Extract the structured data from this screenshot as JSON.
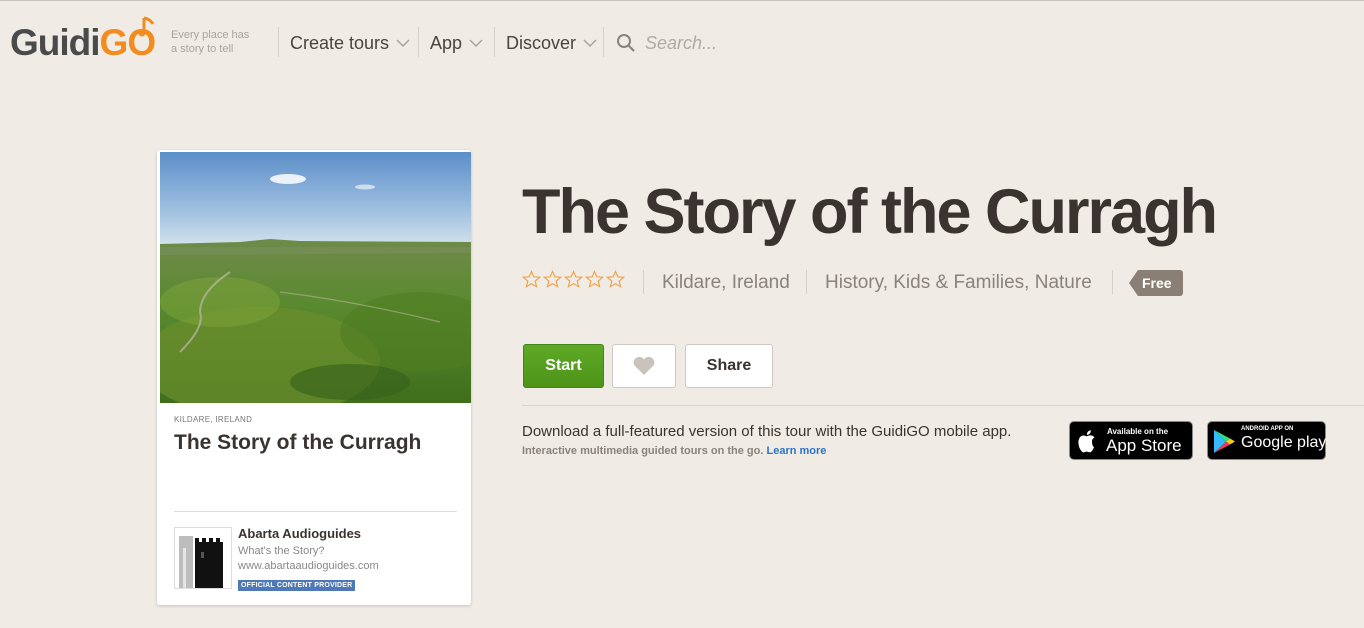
{
  "header": {
    "logo_text": "GuidiGO",
    "logo_main": "Guidi",
    "logo_accent": "GO",
    "tagline_line1": "Every place has",
    "tagline_line2": "a story to tell",
    "nav": [
      {
        "label": "Create tours",
        "icon": "chevron-down-icon"
      },
      {
        "label": "App",
        "icon": "chevron-down-icon"
      },
      {
        "label": "Discover",
        "icon": "chevron-down-icon"
      }
    ],
    "search": {
      "placeholder": "Search...",
      "value": "",
      "icon": "search-icon"
    }
  },
  "card": {
    "location": "KILDARE, IRELAND",
    "title": "The Story of the Curragh",
    "provider": {
      "name": "Abarta Audioguides",
      "subtitle": "What's the Story?",
      "url": "www.abartaaudioguides.com",
      "badge": "OFFICIAL CONTENT PROVIDER"
    }
  },
  "tour": {
    "title": "The Story of the Curragh",
    "rating": 0,
    "rating_max": 5,
    "location": "Kildare, Ireland",
    "categories": "History, Kids & Families, Nature",
    "price": "Free"
  },
  "actions": {
    "start_label": "Start",
    "favorite_icon": "heart-icon",
    "share_label": "Share"
  },
  "download": {
    "text": "Download a full-featured version of this tour with the GuidiGO mobile app.",
    "subtext": "Interactive multimedia guided tours on the go.",
    "learn_more": "Learn more",
    "appstore_small": "Available on the",
    "appstore_big": "App Store",
    "googleplay_small": "ANDROID APP ON",
    "googleplay_big": "Google play"
  },
  "colors": {
    "background": "#f0ebe5",
    "accent_orange": "#f28c1e",
    "start_green": "#5ea925",
    "price_tag": "#8a7f75",
    "badge_blue": "#4e79b6",
    "link_blue": "#2b73c9"
  }
}
